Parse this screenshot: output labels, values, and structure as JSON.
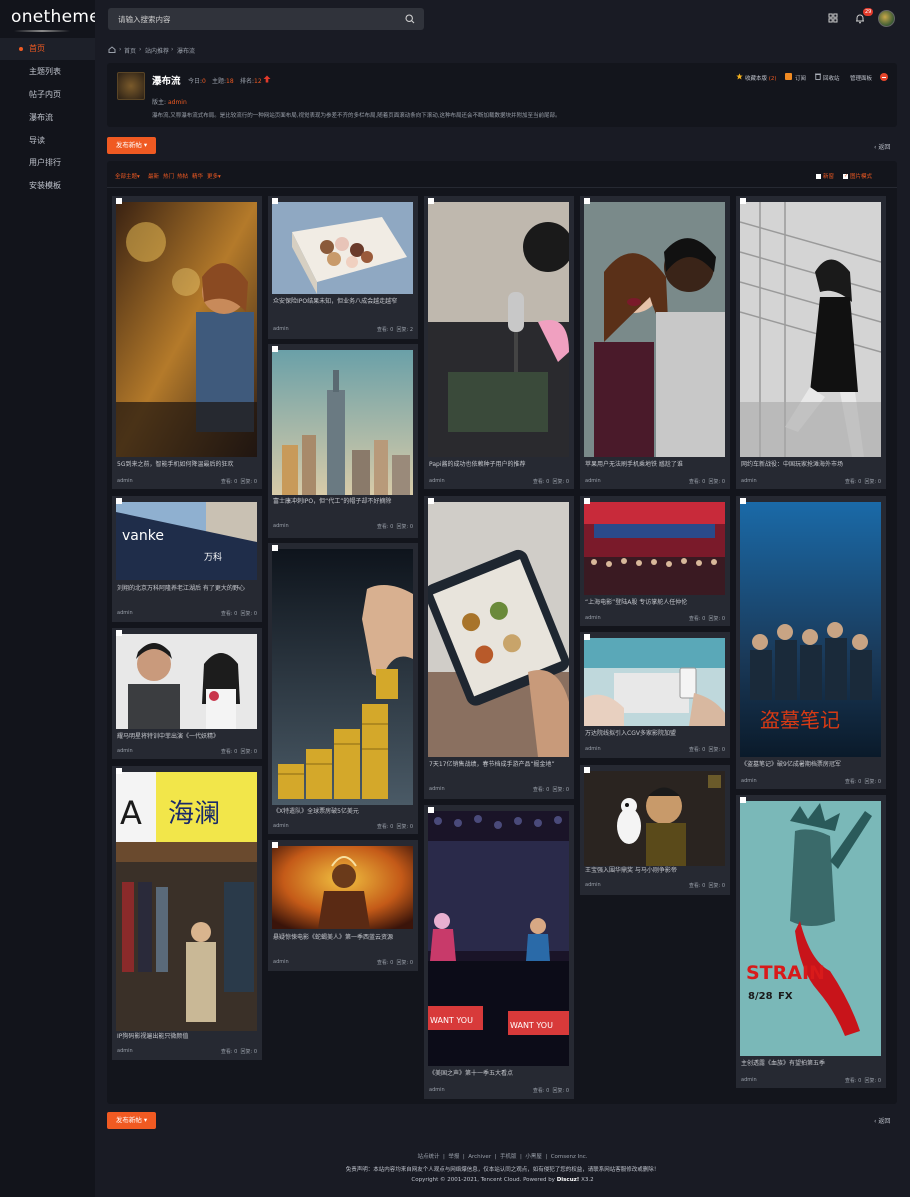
{
  "app": {
    "logo": "onetheme"
  },
  "sidebar": {
    "items": [
      {
        "label": "首页",
        "active": true
      },
      {
        "label": "主题列表"
      },
      {
        "label": "帖子内页"
      },
      {
        "label": "瀑布流"
      },
      {
        "label": "导读"
      },
      {
        "label": "用户排行"
      },
      {
        "label": "安装模板"
      }
    ]
  },
  "header": {
    "search_placeholder": "请输入搜索内容",
    "notif_count": "29"
  },
  "breadcrumb": {
    "items": [
      "首页",
      "站内推荐",
      "瀑布流"
    ],
    "sep": "›"
  },
  "forum": {
    "title": "瀑布流",
    "today_label": "今日:",
    "today": "0",
    "topics_label": "主题:",
    "topics": "18",
    "rank_label": "排名:",
    "rank": "12",
    "fav_label": "收藏本版",
    "fav_count": "(2)",
    "subscribe": "订阅",
    "recycle": "回收站",
    "manage": "管理面板",
    "mod_label": "版主:",
    "moderator": "admin",
    "description": "瀑布流,又称瀑布流式布局。是比较流行的一种网站页面布局,视觉表现为参差不齐的多栏布局,随着页面滚动条向下滚动,这种布局还会不断加载数据块并附加至当前尾部。"
  },
  "toolbar": {
    "post_label": "发布新帖",
    "back_label": "返回"
  },
  "filters": {
    "all": "全部主题",
    "new": "最新",
    "hot": "热门",
    "heat": "热帖",
    "digest": "精华",
    "more": "更多",
    "newwin": "新窗",
    "pic_mode": "图片模式"
  },
  "posts": [
    {
      "title": "5G到来之前，智能手机如何降温最后的狂欢",
      "author": "admin",
      "views_label": "查看:",
      "views": "0",
      "replies_label": "回复:",
      "replies": "0"
    },
    {
      "title": "刘翔的北京万科阿隆养老江湖后 有了更大的野心",
      "author": "admin",
      "views_label": "查看:",
      "views": "0",
      "replies_label": "回复:",
      "replies": "0"
    },
    {
      "title": "耀马明星将特训中菲出演《一代妖精》",
      "author": "admin",
      "views_label": "查看:",
      "views": "0",
      "replies_label": "回复:",
      "replies": "0"
    },
    {
      "title": "IP狗码影视遍出能只微颜值",
      "author": "admin",
      "views_label": "查看:",
      "views": "0",
      "replies_label": "回复:",
      "replies": "0"
    },
    {
      "title": "众安保险IPO结果未知，但业务八成会越走越窄",
      "author": "admin",
      "views_label": "查看:",
      "views": "0",
      "replies_label": "回复:",
      "replies": "2"
    },
    {
      "title": "富士康冲刺IPO，但“代工”的帽子却不好摘除",
      "author": "admin",
      "views_label": "查看:",
      "views": "0",
      "replies_label": "回复:",
      "replies": "0"
    },
    {
      "title": "《X特遣队》全球票房破5亿美元",
      "author": "admin",
      "views_label": "查看:",
      "views": "0",
      "replies_label": "回复:",
      "replies": "0"
    },
    {
      "title": "悬疑惊悚电影《蛇蝎美人》第一季西蓝云资源",
      "author": "admin",
      "views_label": "查看:",
      "views": "0",
      "replies_label": "回复:",
      "replies": "0"
    },
    {
      "title": "Papi酱的成功也依赖种子用户的推荐",
      "author": "admin",
      "views_label": "查看:",
      "views": "0",
      "replies_label": "回复:",
      "replies": "0"
    },
    {
      "title": "7天17亿销售战绩，春节档成手游产品“掘金地”",
      "author": "admin",
      "views_label": "查看:",
      "views": "0",
      "replies_label": "回复:",
      "replies": "0"
    },
    {
      "title": "《美国之声》第十一季五大看点",
      "author": "admin",
      "views_label": "查看:",
      "views": "0",
      "replies_label": "回复:",
      "replies": "0"
    },
    {
      "title": "苹果用户无法刷手机乘地铁 尴尬了谁",
      "author": "admin",
      "views_label": "查看:",
      "views": "0",
      "replies_label": "回复:",
      "replies": "0"
    },
    {
      "title": "“上海电影”登陆A股 专访掌舵人任仲伦",
      "author": "admin",
      "views_label": "查看:",
      "views": "0",
      "replies_label": "回复:",
      "replies": "0"
    },
    {
      "title": "万达院线拟引入CGV多家影院加盟",
      "author": "admin",
      "views_label": "查看:",
      "views": "0",
      "replies_label": "回复:",
      "replies": "0"
    },
    {
      "title": "王宝强入围华鼎奖 与马小刚争影帝",
      "author": "admin",
      "views_label": "查看:",
      "views": "0",
      "replies_label": "回复:",
      "replies": "0"
    },
    {
      "title": "网约车新战役：中国玩家抢滩海外市场",
      "author": "admin",
      "views_label": "查看:",
      "views": "0",
      "replies_label": "回复:",
      "replies": "0"
    },
    {
      "title": "《盗墓笔记》破9亿成暑期档票房冠军",
      "author": "admin",
      "views_label": "查看:",
      "views": "0",
      "replies_label": "回复:",
      "replies": "0"
    },
    {
      "title": "主创透露《血族》有望拍第五季",
      "author": "admin",
      "views_label": "查看:",
      "views": "0",
      "replies_label": "回复:",
      "replies": "0"
    }
  ],
  "images": {
    "vanke_sign": "vanke",
    "vanke_sub": "万科",
    "haibang": "海澜",
    "poster_title": "盗墓笔记",
    "strain": "STRAIN",
    "strain_date": "8/28",
    "strain_net": "FX",
    "voice": "WANT YOU"
  },
  "footer": {
    "links": [
      "站点统计",
      "举报",
      "Archiver",
      "手机版",
      "小黑屋",
      "Comsenz Inc."
    ],
    "note": "免责声明：本站内容均来自网友个人观点与网络爆信息，仅本站认同之观点，如有侵犯了您的权益，请联系网站客服修改或删除！",
    "copyright_prefix": "Copyright © 2001-2021, Tencent Cloud.",
    "powered_by": "Powered by",
    "powered_name": "Discuz!",
    "powered_ver": "X3.2"
  }
}
